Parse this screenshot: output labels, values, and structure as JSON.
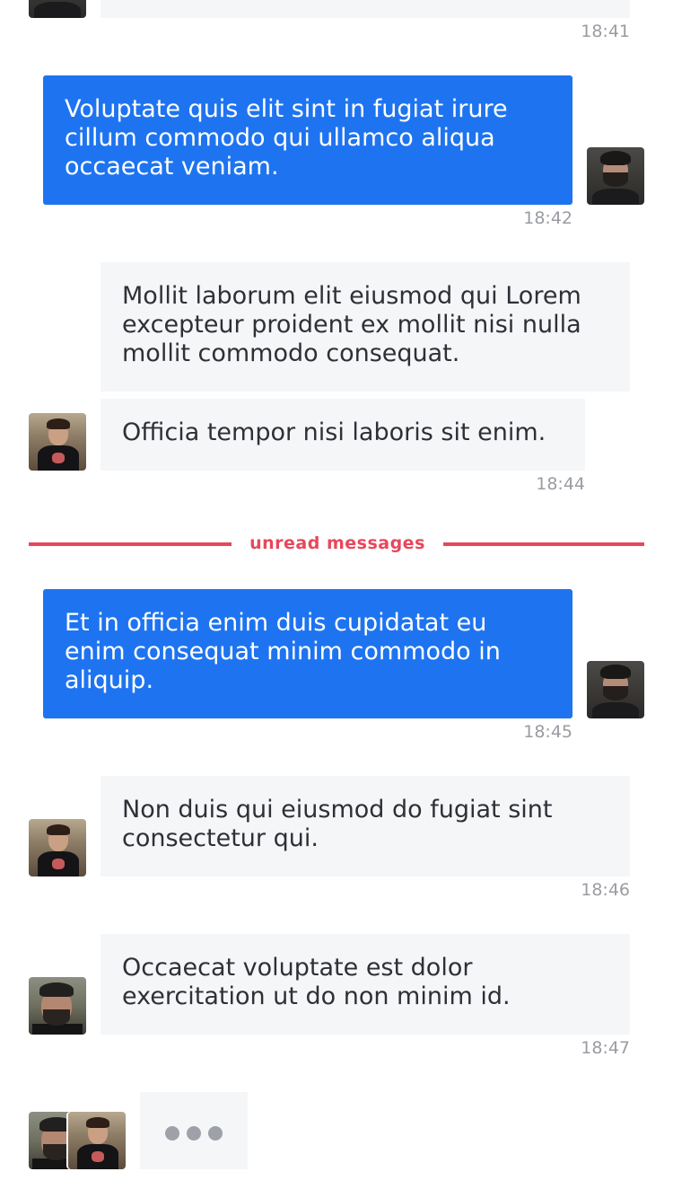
{
  "messages": [
    {
      "text": "Voluptate quis elit sint in fugiat irure cillum commodo qui ullamco aliqua occaecat veniam.",
      "time": "18:42"
    },
    {
      "text": "Mollit laborum elit eiusmod qui Lorem excepteur proident ex mollit nisi nulla mollit commodo consequat."
    },
    {
      "text": "Officia tempor nisi laboris sit enim.",
      "time": "18:44"
    },
    {
      "text": "Et in officia enim duis cupidatat eu enim consequat minim commodo in aliquip.",
      "time": "18:45"
    },
    {
      "text": "Non duis qui eiusmod do fugiat sint consectetur qui.",
      "time": "18:46"
    },
    {
      "text": "Occaecat voluptate est dolor exercitation ut do non minim id.",
      "time": "18:47"
    }
  ],
  "top_partial": {
    "time": "18:41"
  },
  "divider": {
    "label": "unread messages"
  },
  "colors": {
    "outgoing": "#1e74f0",
    "incoming": "#f5f6f8",
    "unread": "#e8475b",
    "timestamp": "#9a9ca2"
  }
}
